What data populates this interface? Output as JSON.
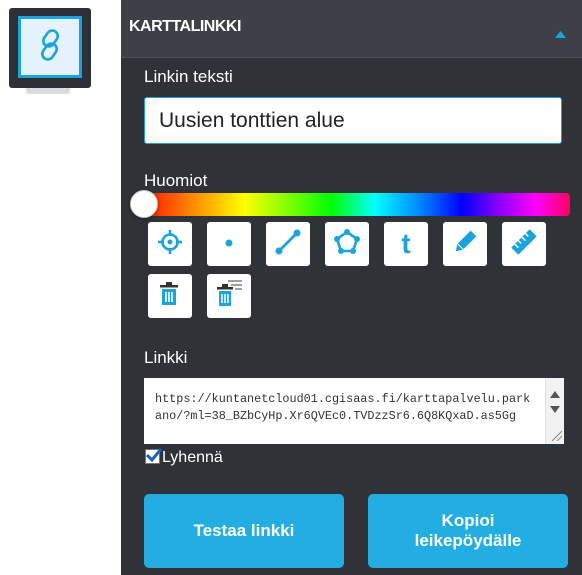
{
  "toolbar": {
    "active_tool_icon": "link-icon"
  },
  "panel": {
    "title": "KARTTALINKKI",
    "link_text_label": "Linkin teksti",
    "link_text_value": "Uusien tonttien alue",
    "notes_label": "Huomiot",
    "draw_tools": [
      {
        "icon": "crosshair-icon"
      },
      {
        "icon": "point-icon"
      },
      {
        "icon": "line-icon"
      },
      {
        "icon": "polygon-icon"
      },
      {
        "icon": "text-icon",
        "glyph": "t"
      },
      {
        "icon": "pencil-icon"
      },
      {
        "icon": "ruler-icon"
      },
      {
        "icon": "trash-icon"
      },
      {
        "icon": "trash-list-icon"
      }
    ],
    "link_label": "Linkki",
    "link_url": "https://kuntanetcloud01.cgisaas.fi/karttapalvelu.parkano/?ml=38_BZbCyHp.Xr6QVEc0.TVDzzSr6.6Q8KQxaD.as5Gg",
    "shorten_label": "Lyhennä",
    "shorten_checked": true,
    "test_button": "Testaa linkki",
    "copy_button_line1": "Kopioi",
    "copy_button_line2": "leikepöydälle"
  },
  "colors": {
    "accent": "#1aa3dd",
    "button": "#22aee3",
    "panel_bg": "#2f3237",
    "header_bg": "#3d4147"
  }
}
